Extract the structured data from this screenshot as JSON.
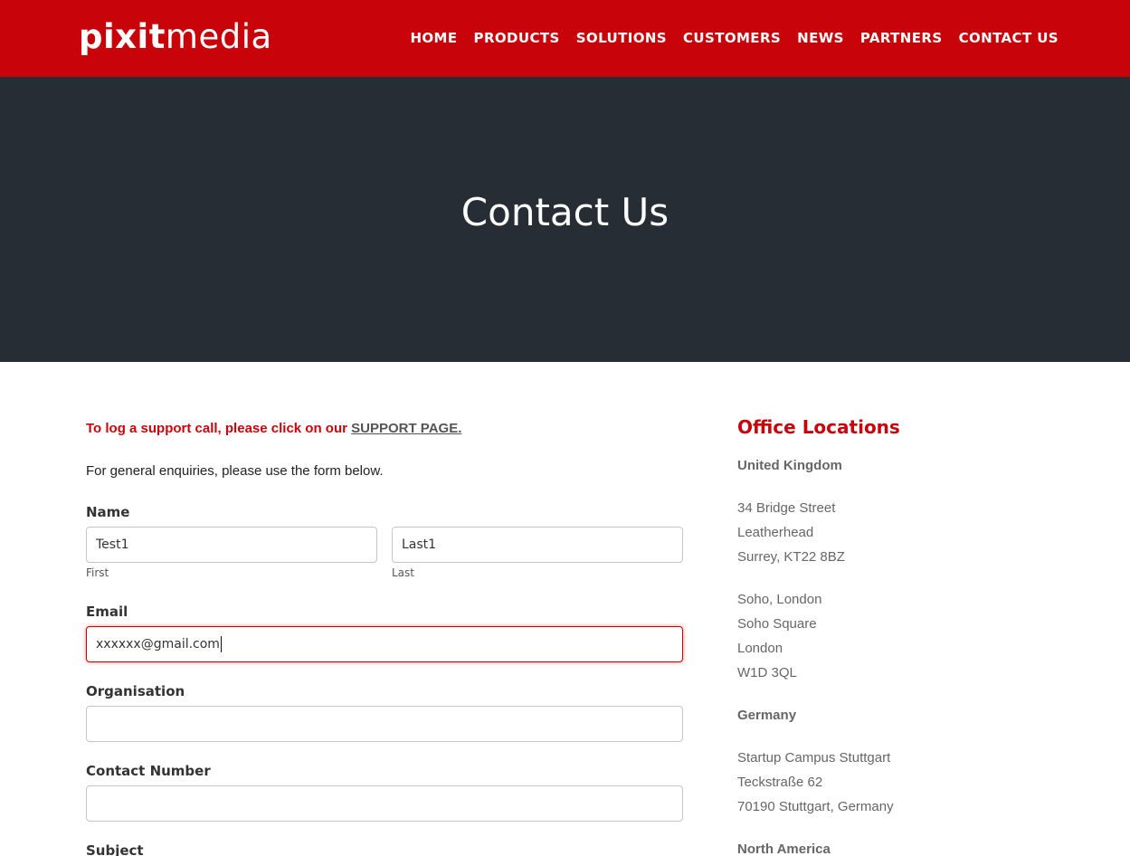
{
  "brand": {
    "logo_bold": "pixit",
    "logo_light": "media",
    "accent_color": "#c8040a",
    "hero_bg": "#272d35"
  },
  "nav": [
    "HOME",
    "PRODUCTS",
    "SOLUTIONS",
    "CUSTOMERS",
    "NEWS",
    "PARTNERS",
    "CONTACT US"
  ],
  "hero": {
    "title": "Contact Us"
  },
  "form": {
    "support_text": "To log a support call, please click on our ",
    "support_link": "SUPPORT PAGE.",
    "intro": "For general enquiries, please use the form below.",
    "name_label": "Name",
    "first_value": "Test1",
    "first_sub": "First",
    "last_value": "Last1",
    "last_sub": "Last",
    "email_label": "Email",
    "email_value": "xxxxxx@gmail.com",
    "organisation_label": "Organisation",
    "organisation_value": "",
    "contact_label": "Contact Number",
    "contact_value": "",
    "subject_label": "Subject"
  },
  "offices": {
    "title": "Office Locations",
    "uk_title": "United Kingdom",
    "uk_office1": [
      "34 Bridge Street",
      "Leatherhead",
      "Surrey, KT22 8BZ"
    ],
    "uk_office2": [
      "Soho, London",
      "Soho Square",
      "London",
      "W1D 3QL"
    ],
    "de_title": "Germany",
    "de_office": [
      "Startup Campus Stuttgart",
      "Teckstraße 62",
      "70190 Stuttgart, Germany"
    ],
    "na_title": "North America"
  }
}
